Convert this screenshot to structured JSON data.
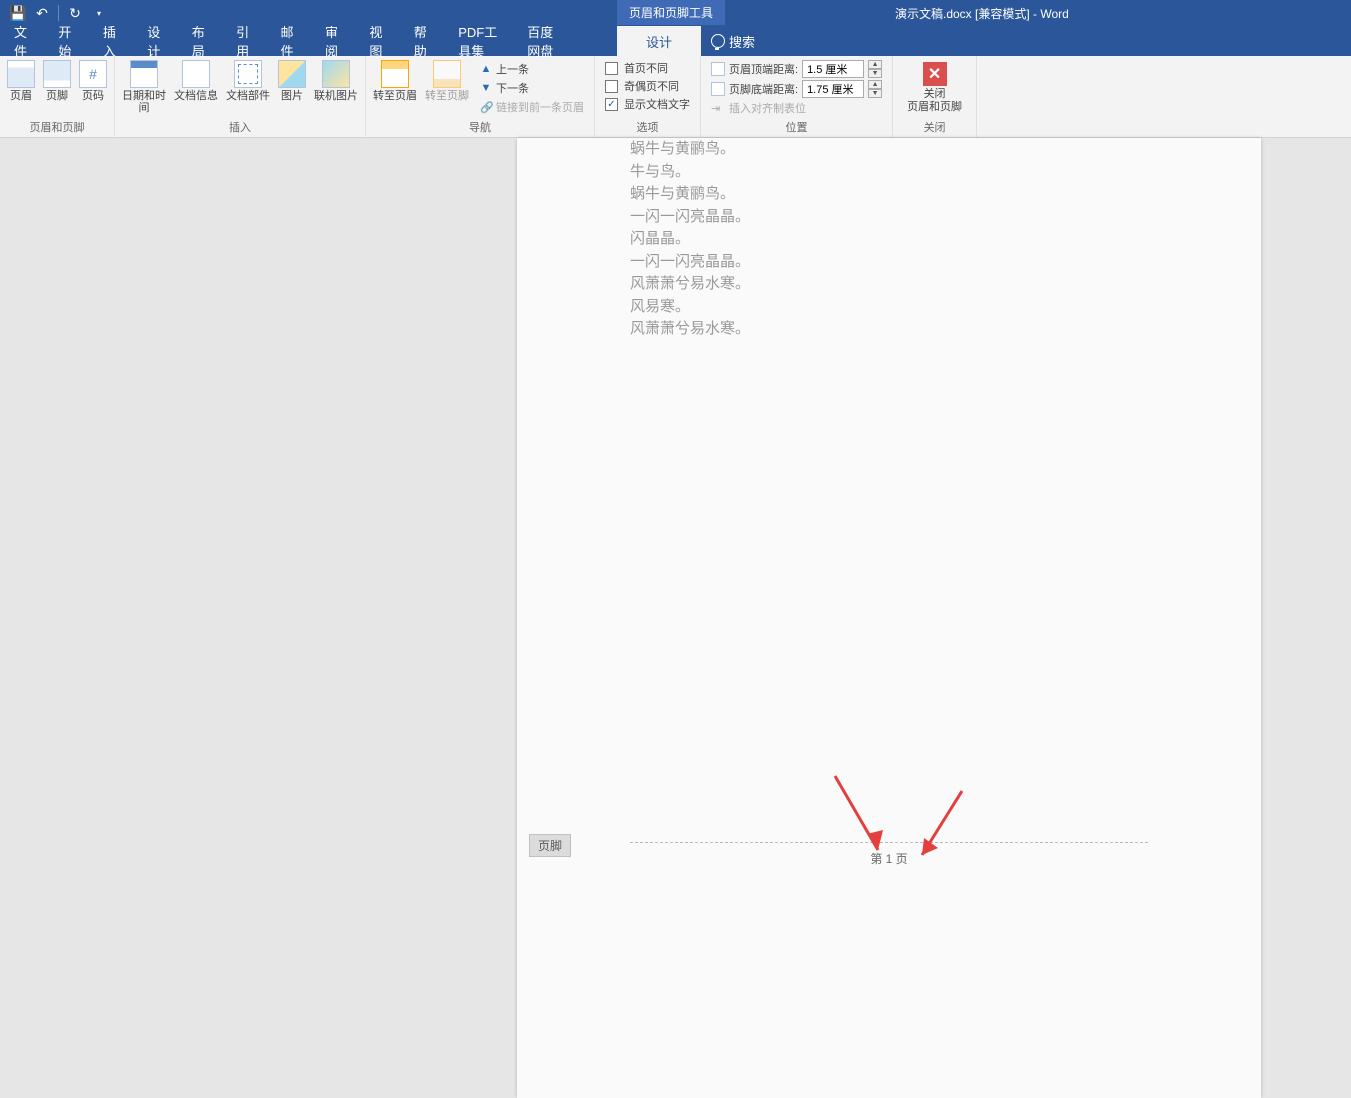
{
  "titlebar": {
    "contextual_label": "页眉和页脚工具",
    "title": "演示文稿.docx [兼容模式] - Word"
  },
  "tabs": {
    "file": "文件",
    "home": "开始",
    "insert": "插入",
    "design": "设计",
    "layout": "布局",
    "references": "引用",
    "mailings": "邮件",
    "review": "审阅",
    "view": "视图",
    "help": "帮助",
    "pdf": "PDF工具集",
    "baidu": "百度网盘",
    "hf_design": "设计",
    "search": "搜索"
  },
  "ribbon": {
    "hf_group": "页眉和页脚",
    "header": "页眉",
    "footer": "页脚",
    "pagenum": "页码",
    "insert_group": "插入",
    "date": "日期和时间",
    "info": "文档信息",
    "parts": "文档部件",
    "image": "图片",
    "online_img": "联机图片",
    "nav_group": "导航",
    "goto_header": "转至页眉",
    "goto_footer": "转至页脚",
    "prev": "上一条",
    "next": "下一条",
    "link_prev": "链接到前一条页眉",
    "options_group": "选项",
    "first_diff": "首页不同",
    "odd_even": "奇偶页不同",
    "show_text": "显示文档文字",
    "position_group": "位置",
    "header_top": "页眉顶端距离:",
    "footer_bottom": "页脚底端距离:",
    "header_top_val": "1.5 厘米",
    "footer_bottom_val": "1.75 厘米",
    "insert_align": "插入对齐制表位",
    "close_group": "关闭",
    "close_hf": "关闭\n页眉和页脚"
  },
  "doc": {
    "lines": [
      "蜗牛与黄鹂鸟。",
      "牛与鸟。",
      "蜗牛与黄鹂鸟。",
      "一闪一闪亮晶晶。",
      "闪晶晶。",
      "一闪一闪亮晶晶。",
      "风萧萧兮易水寒。",
      "风易寒。",
      "风萧萧兮易水寒。"
    ],
    "footer_tag": "页脚",
    "page_num": "第 1 页"
  }
}
